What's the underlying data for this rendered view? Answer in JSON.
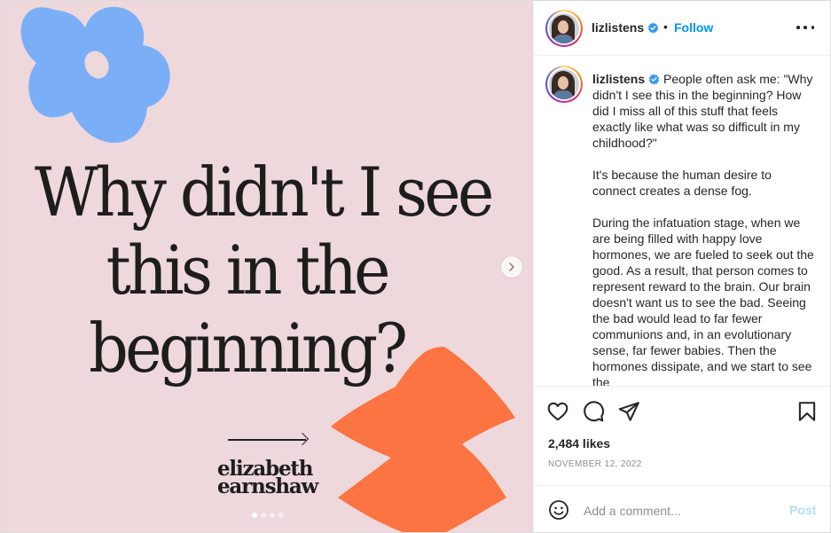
{
  "colors": {
    "media_bg": "#eed8dc",
    "blue_shape": "#7aaef7",
    "orange_shape": "#fb7442",
    "follow_blue": "#0095f6",
    "post_disabled": "#b2dffc"
  },
  "media": {
    "headline_lines": [
      "Why didn't I see",
      "this in the",
      "beginning?"
    ],
    "brand_lines": [
      "elizabeth",
      "earnshaw"
    ],
    "carousel": {
      "total": 4,
      "current": 1
    }
  },
  "header": {
    "username": "lizlistens",
    "follow_label": "Follow",
    "separator": "•"
  },
  "caption": {
    "username": "lizlistens",
    "paragraphs": [
      "People often ask me: \"Why didn't I see this in the beginning? How did I miss all of this stuff that feels exactly like what was so difficult in my childhood?\"",
      "It's because the human desire to connect creates a dense fog.",
      "During the infatuation stage, when we are being filled with happy love hormones, we are fueled to seek out the good. As a result, that person comes to represent reward to the brain. Our brain doesn't want us to see the bad. Seeing the bad would lead to far fewer communions and, in an evolutionary sense, far fewer babies. Then the hormones dissipate, and we start to see the"
    ]
  },
  "actions": {
    "like_icon": "heart-icon",
    "comment_icon": "comment-icon",
    "share_icon": "share-icon",
    "save_icon": "bookmark-icon"
  },
  "stats": {
    "likes": "2,484 likes",
    "date": "NOVEMBER 12, 2022"
  },
  "comment": {
    "placeholder": "Add a comment...",
    "post_label": "Post"
  }
}
